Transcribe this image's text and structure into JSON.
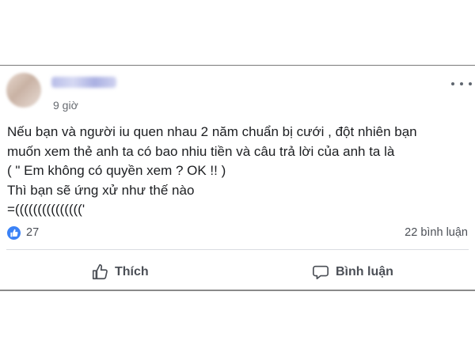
{
  "post": {
    "timestamp": "9 giờ",
    "body_lines": [
      "Nếu bạn và người iu quen nhau 2 năm chuẩn bị cưới , đột nhiên bạn",
      "muốn xem thẻ anh ta có bao nhiu tiền và câu trả lời của anh ta là",
      "( \" Em không có quyền xem ? OK !! )",
      "Thì bạn sẽ ứng xử như thế nào",
      "=((((((((((((((('"
    ]
  },
  "stats": {
    "reaction_count": "27",
    "comment_count": "22 bình luận"
  },
  "actions": {
    "like_label": "Thích",
    "comment_label": "Bình luận"
  },
  "icons": {
    "more": "more-horizontal-icon",
    "like_badge": "like-reaction-icon",
    "like_button": "thumbs-up-icon",
    "comment_button": "comment-bubble-icon"
  },
  "colors": {
    "like_badge": "#3b82f6",
    "text": "#1c1e21",
    "secondary_text": "#4b4f56"
  }
}
